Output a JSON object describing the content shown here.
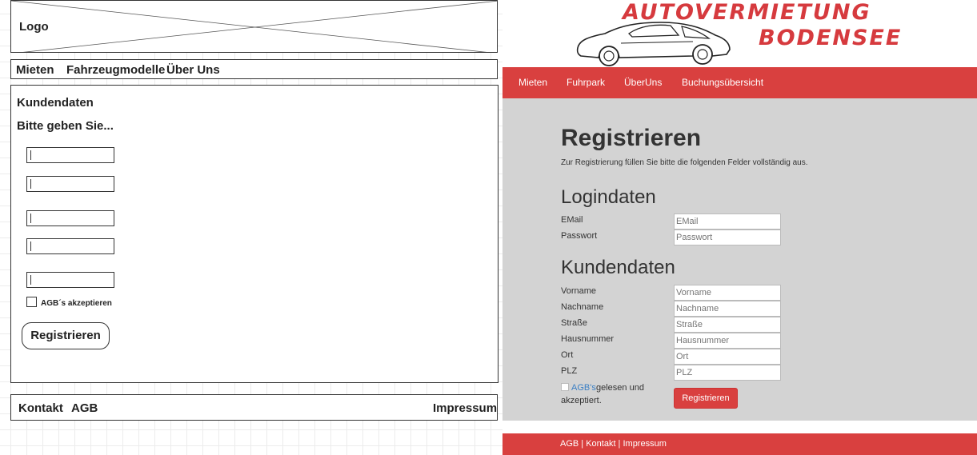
{
  "wireframe": {
    "logo_label": "Logo",
    "nav": [
      "Mieten",
      "Fahrzeugmodelle",
      "Über Uns"
    ],
    "heading": "Kundendaten",
    "subheading": "Bitte geben Sie...",
    "checkbox_label": "AGB´s akzeptieren",
    "register_label": "Registrieren",
    "footer": {
      "contact": "Kontakt",
      "agb": "AGB",
      "imprint": "Impressum"
    }
  },
  "site": {
    "brand_line1": "AUTOVERMIETUNG",
    "brand_line2": "BODENSEE",
    "nav": [
      "Mieten",
      "Fuhrpark",
      "ÜberUns",
      "Buchungsübersicht"
    ],
    "title": "Registrieren",
    "intro": "Zur Registrierung füllen Sie bitte die folgenden Felder vollständig aus.",
    "login_section": "Logindaten",
    "login_fields": [
      {
        "label": "EMail",
        "placeholder": "EMail"
      },
      {
        "label": "Passwort",
        "placeholder": "Passwort"
      }
    ],
    "customer_section": "Kundendaten",
    "customer_fields": [
      {
        "label": "Vorname",
        "placeholder": "Vorname"
      },
      {
        "label": "Nachname",
        "placeholder": "Nachname"
      },
      {
        "label": "Straße",
        "placeholder": "Straße"
      },
      {
        "label": "Hausnummer",
        "placeholder": "Hausnummer"
      },
      {
        "label": "Ort",
        "placeholder": "Ort"
      },
      {
        "label": "PLZ",
        "placeholder": "PLZ"
      }
    ],
    "agb_link": "AGB's",
    "agb_text1": "gelesen und",
    "agb_text2": "akzeptiert.",
    "register_label": "Registrieren",
    "footer_text": "AGB | Kontakt | Impressum",
    "accent_color": "#d9403f",
    "body_bg": "#d3d3d3"
  }
}
